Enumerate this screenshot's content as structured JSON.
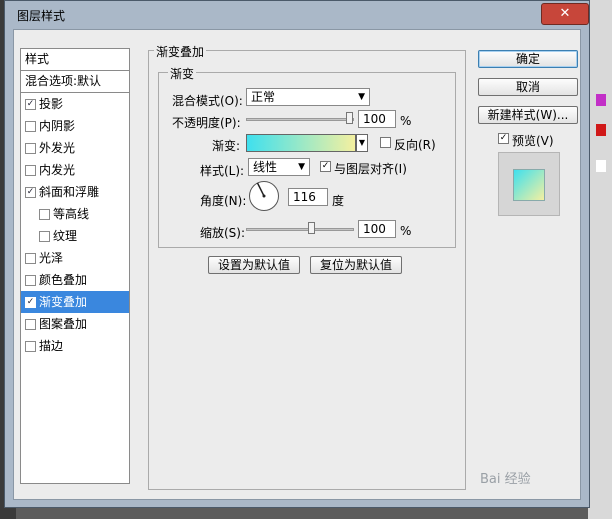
{
  "window": {
    "title": "图层样式",
    "close_label": "✕"
  },
  "styles_panel": {
    "header": "样式",
    "blend_options": "混合选项:默认",
    "items": [
      {
        "label": "投影",
        "checked": true,
        "sub": false,
        "selected": false
      },
      {
        "label": "内阴影",
        "checked": false,
        "sub": false,
        "selected": false
      },
      {
        "label": "外发光",
        "checked": false,
        "sub": false,
        "selected": false
      },
      {
        "label": "内发光",
        "checked": false,
        "sub": false,
        "selected": false
      },
      {
        "label": "斜面和浮雕",
        "checked": true,
        "sub": false,
        "selected": false
      },
      {
        "label": "等高线",
        "checked": false,
        "sub": true,
        "selected": false
      },
      {
        "label": "纹理",
        "checked": false,
        "sub": true,
        "selected": false
      },
      {
        "label": "光泽",
        "checked": false,
        "sub": false,
        "selected": false
      },
      {
        "label": "颜色叠加",
        "checked": false,
        "sub": false,
        "selected": false
      },
      {
        "label": "渐变叠加",
        "checked": true,
        "sub": false,
        "selected": true
      },
      {
        "label": "图案叠加",
        "checked": false,
        "sub": false,
        "selected": false
      },
      {
        "label": "描边",
        "checked": false,
        "sub": false,
        "selected": false
      }
    ]
  },
  "gradient_overlay": {
    "section_title": "渐变叠加",
    "group_title": "渐变",
    "blend_mode_label": "混合模式(O):",
    "blend_mode_value": "正常",
    "opacity_label": "不透明度(P):",
    "opacity_value": "100",
    "percent": "%",
    "gradient_label": "渐变:",
    "reverse_label": "反向(R)",
    "reverse_checked": false,
    "style_label": "样式(L):",
    "style_value": "线性",
    "align_label": "与图层对齐(I)",
    "align_checked": true,
    "angle_label": "角度(N):",
    "angle_value": "116",
    "angle_unit": "度",
    "scale_label": "缩放(S):",
    "scale_value": "100",
    "make_default": "设置为默认值",
    "reset_default": "复位为默认值"
  },
  "actions": {
    "ok": "确定",
    "cancel": "取消",
    "new_style": "新建样式(W)...",
    "preview_label": "预览(V)",
    "preview_checked": true
  },
  "watermark": "Bai 经验"
}
